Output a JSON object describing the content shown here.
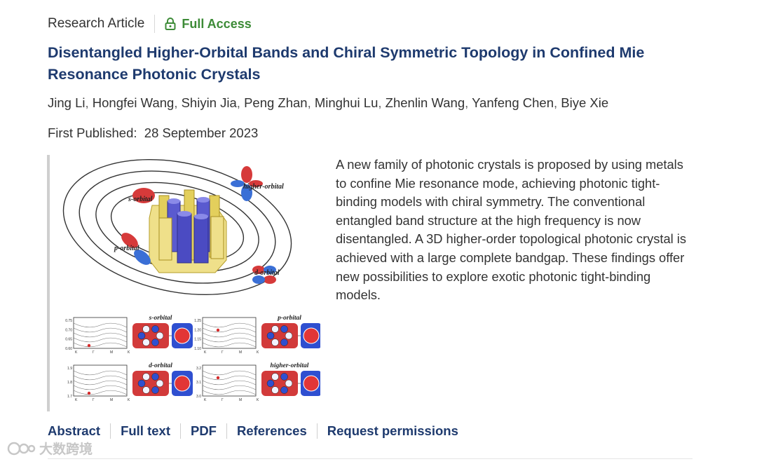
{
  "article": {
    "type_label": "Research Article",
    "access_label": "Full Access",
    "title": "Disentangled Higher-Orbital Bands and Chiral Symmetric Topology in Confined Mie Resonance Photonic Crystals",
    "authors": [
      "Jing Li",
      "Hongfei Wang",
      "Shiyin Jia",
      "Peng Zhan",
      "Minghui Lu",
      "Zhenlin Wang",
      "Yanfeng Chen",
      "Biye Xie"
    ],
    "author_separator": ",",
    "published_label": "First Published:",
    "published_date": "28 September 2023",
    "abstract_text": "A new family of photonic crystals is proposed by using metals to confine Mie resonance mode, achieving photonic tight-binding models with chiral symmetry. The conventional entangled band structure at the high frequency is now disentangled. A 3D higher-order topological photonic crystal is achieved with a large complete bandgap. These findings offer new possibilities to explore exotic photonic tight-binding models."
  },
  "figure": {
    "orbital_labels": [
      "higher-orbital",
      "s-orbital",
      "p-orbital",
      "d-orbital"
    ],
    "panels": [
      {
        "title": "s-orbital",
        "yticks": [
          "0.75",
          "0.70",
          "0.65",
          "0.60"
        ],
        "xticks": [
          "K",
          "Γ",
          "M",
          "K"
        ]
      },
      {
        "title": "p-orbital",
        "yticks": [
          "1.25",
          "1.20",
          "1.15",
          "1.10"
        ],
        "xticks": [
          "K",
          "Γ",
          "M",
          "K"
        ]
      },
      {
        "title": "d-orbital",
        "yticks": [
          "1.9",
          "1.8",
          "1.7"
        ],
        "xticks": [
          "K",
          "Γ",
          "M",
          "K"
        ]
      },
      {
        "title": "higher-orbital",
        "yticks": [
          "3.2",
          "3.1",
          "3.0"
        ],
        "xticks": [
          "K",
          "Γ",
          "M",
          "K"
        ]
      }
    ]
  },
  "tabs": [
    "Abstract",
    "Full text",
    "PDF",
    "References",
    "Request permissions"
  ],
  "watermark": "大数跨境",
  "colors": {
    "title": "#1e3a6e",
    "access": "#3d8b37",
    "text": "#333333"
  }
}
